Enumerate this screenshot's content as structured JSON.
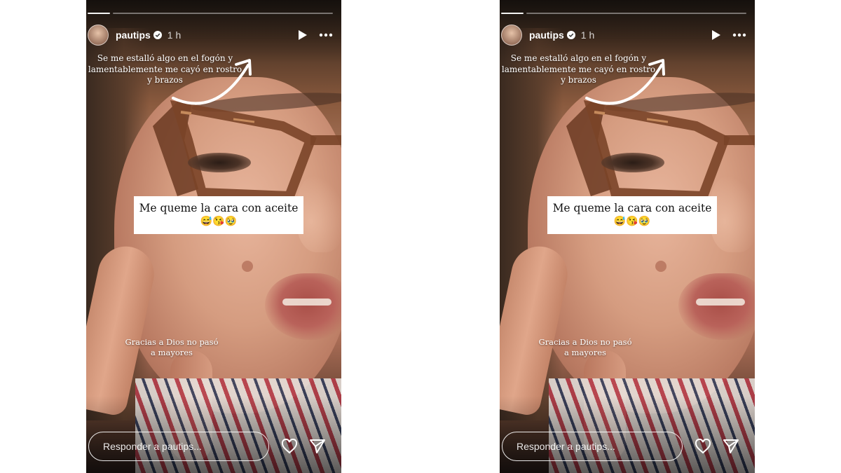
{
  "stories": [
    {
      "username": "pautips",
      "time": "1 h",
      "caption_top": "Se me estalló algo en el fogón y lamentablemente me cayó en rostro y brazos",
      "sticker_text": "Me queme la cara con aceite",
      "sticker_emojis": "😅😘🥹",
      "caption_bottom": "Gracias a Dios no pasó a mayores",
      "reply_placeholder": "Responder a pautips...",
      "icons": [
        "verified-badge-icon",
        "play-icon",
        "more-options-icon",
        "heart-icon",
        "send-icon",
        "curved-arrow-icon"
      ]
    },
    {
      "username": "pautips",
      "time": "1 h",
      "caption_top": "Se me estalló algo en el fogón y lamentablemente me cayó en rostro y brazos",
      "sticker_text": "Me queme la cara con aceite",
      "sticker_emojis": "😅😘🥹",
      "caption_bottom": "Gracias a Dios no pasó a mayores",
      "reply_placeholder": "Responder a pautips...",
      "icons": [
        "verified-badge-icon",
        "play-icon",
        "more-options-icon",
        "heart-icon",
        "send-icon",
        "curved-arrow-icon"
      ]
    }
  ],
  "colors": {
    "sticker_bg": "#ffffff",
    "text": "#ffffff"
  }
}
